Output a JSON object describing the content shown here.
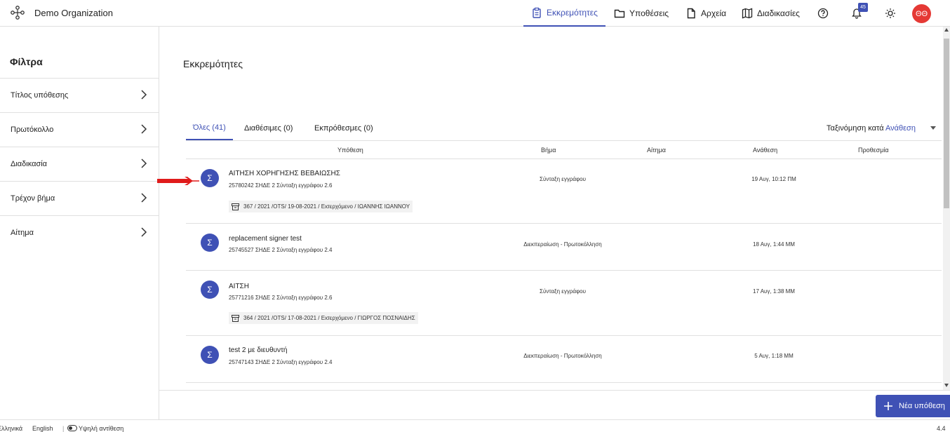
{
  "header": {
    "org_name": "Demo Organization",
    "nav": [
      {
        "label": "Εκκρεμότητες",
        "icon": "clipboard-icon",
        "active": true
      },
      {
        "label": "Υποθέσεις",
        "icon": "folder-icon"
      },
      {
        "label": "Αρχεία",
        "icon": "file-icon"
      },
      {
        "label": "Διαδικασίες",
        "icon": "map-icon"
      }
    ],
    "notifications_count": "45",
    "avatar_initials": "ΘΘ"
  },
  "sidebar": {
    "title": "Φίλτρα",
    "filters": [
      "Τίτλος υπόθεσης",
      "Πρωτόκολλο",
      "Διαδικασία",
      "Τρέχον βήμα",
      "Αίτημα"
    ]
  },
  "main": {
    "title": "Εκκρεμότητες",
    "tabs": [
      "Όλες (41)",
      "Διαθέσιμες (0)",
      "Εκπρόθεσμες (0)"
    ],
    "sort_label": "Ταξινόμηση κατά",
    "sort_value": "Ανάθεση",
    "columns": [
      "Υπόθεση",
      "Βήμα",
      "Αίτημα",
      "Ανάθεση",
      "Προθεσμία"
    ],
    "rows": [
      {
        "avatar": "Σ",
        "title": "ΑΙΤΗΣΗ ΧΟΡΗΓΗΣΗΣ ΒΕΒΑΙΩΣΗΣ",
        "subtitle": "25780242   ΣΗΔΕ 2 Σύνταξη εγγράφου   2.6",
        "step": "Σύνταξη εγγράφου",
        "assigned": "19 Αυγ, 10:12 ΠΜ",
        "protocol": "367 / 2021 /OTS/ 19-08-2021 / Εισερχόμενο / ΙΩΑΝΝΗΣ ΙΩΑΝΝΟΥ"
      },
      {
        "avatar": "Σ",
        "title": "replacement signer test",
        "subtitle": "25745527   ΣΗΔΕ 2 Σύνταξη εγγράφου   2.4",
        "step": "Διεκπεραίωση - Πρωτοκόλληση",
        "assigned": "18 Αυγ, 1:44 ΜΜ"
      },
      {
        "avatar": "Σ",
        "title": "ΑΙΤΣΗ",
        "subtitle": "25771216   ΣΗΔΕ 2 Σύνταξη εγγράφου   2.6",
        "step": "Σύνταξη εγγράφου",
        "assigned": "17 Αυγ, 1:38 ΜΜ",
        "protocol": "364 / 2021 /OTS/ 17-08-2021 / Εισερχόμενο / ΓΙΩΡΓΟΣ ΠΟΣΝΑΙΔΗΣ"
      },
      {
        "avatar": "Σ",
        "title": "test 2 με διευθυντή",
        "subtitle": "25747143   ΣΗΔΕ 2 Σύνταξη εγγράφου   2.4",
        "step": "Διεκπεραίωση - Πρωτοκόλληση",
        "assigned": "5 Αυγ, 1:18 ΜΜ"
      }
    ],
    "new_case_label": "Νέα υπόθεση"
  },
  "footer": {
    "lang_el": "Ελληνικά",
    "lang_en": "English",
    "contrast_label": "Υψηλή αντίθεση",
    "version": "4.4"
  },
  "colors": {
    "accent": "#3f51b5",
    "avatar": "#e53935",
    "arrow": "#e01b1b"
  }
}
